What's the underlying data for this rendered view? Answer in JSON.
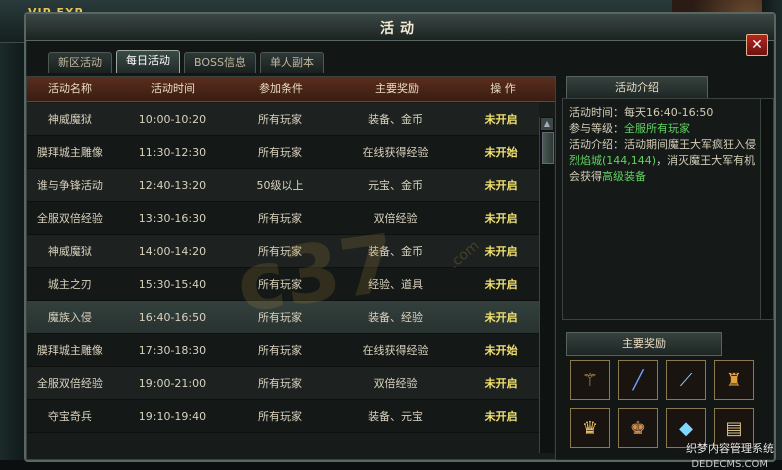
{
  "hud": {
    "vip": "VIP",
    "exp": "EXP"
  },
  "window": {
    "title": "活动",
    "close_label": "✕"
  },
  "tabs": [
    {
      "label": "新区活动"
    },
    {
      "label": "每日活动"
    },
    {
      "label": "BOSS信息"
    },
    {
      "label": "单人副本"
    }
  ],
  "table": {
    "headers": [
      "活动名称",
      "活动时间",
      "参加条件",
      "主要奖励",
      "操 作"
    ],
    "rows": [
      [
        "神威魔狱",
        "10:00-10:20",
        "所有玩家",
        "装备、金币",
        "未开启"
      ],
      [
        "膜拜城主雕像",
        "11:30-12:30",
        "所有玩家",
        "在线获得经验",
        "未开始"
      ],
      [
        "谁与争锋活动",
        "12:40-13:20",
        "50级以上",
        "元宝、金币",
        "未开启"
      ],
      [
        "全服双倍经验",
        "13:30-16:30",
        "所有玩家",
        "双倍经验",
        "未开启"
      ],
      [
        "神威魔狱",
        "14:00-14:20",
        "所有玩家",
        "装备、金币",
        "未开启"
      ],
      [
        "城主之刃",
        "15:30-15:40",
        "所有玩家",
        "经验、道具",
        "未开启"
      ],
      [
        "魔族入侵",
        "16:40-16:50",
        "所有玩家",
        "装备、经验",
        "未开启"
      ],
      [
        "膜拜城主雕像",
        "17:30-18:30",
        "所有玩家",
        "在线获得经验",
        "未开始"
      ],
      [
        "全服双倍经验",
        "19:00-21:00",
        "所有玩家",
        "双倍经验",
        "未开启"
      ],
      [
        "夺宝奇兵",
        "19:10-19:40",
        "所有玩家",
        "装备、元宝",
        "未开启"
      ]
    ],
    "highlight_row": 6
  },
  "info": {
    "head": "活动介绍",
    "time_label": "活动时间：每天",
    "time_value": "16:40-16:50",
    "level_label": "参与等级：",
    "level_value": "全服所有玩家",
    "desc_label": "活动介绍：活动期间魔王大军疯狂入侵",
    "desc_place": "烈焰城(144,144)",
    "desc_mid": "，消灭魔王大军有机会获得",
    "desc_reward": "高级装备"
  },
  "rewards": {
    "head": "主要奖励",
    "items": [
      {
        "icon": "polearm-icon"
      },
      {
        "icon": "spear-icon"
      },
      {
        "icon": "staff-icon"
      },
      {
        "icon": "armor-icon"
      },
      {
        "icon": "gold-armor-icon"
      },
      {
        "icon": "robe-armor-icon"
      },
      {
        "icon": "crystal-icon"
      },
      {
        "icon": "scroll-icon"
      }
    ]
  },
  "watermarks": {
    "main": "c37",
    "small": ".com",
    "footer1": "织梦内容管理系统",
    "footer2": "DEDECMS.COM"
  },
  "colors": {
    "status": "#f0e070",
    "highlight_green": "#5fd35f",
    "header_bg": "#5a2e1e"
  }
}
